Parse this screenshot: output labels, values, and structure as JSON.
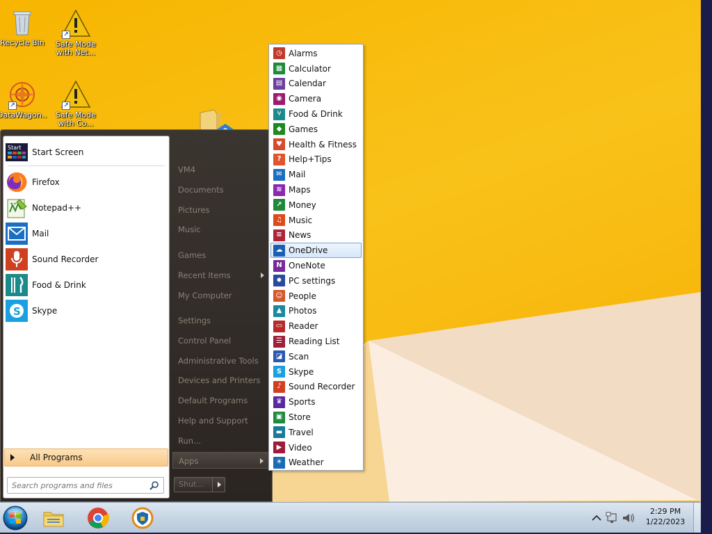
{
  "desktop": {
    "icons": [
      {
        "name": "desktop-icon-recycle-bin",
        "label": "Recycle Bin",
        "icon": "recycle-bin-icon"
      },
      {
        "name": "desktop-icon-safe-mode-net",
        "label": "Safe Mode with Net...",
        "icon": "warning-icon"
      },
      {
        "name": "desktop-icon-datawagon",
        "label": "DataWagon...",
        "icon": "datawagon-icon"
      },
      {
        "name": "desktop-icon-safe-mode",
        "label": "Safe Mode with Co...",
        "icon": "warning-icon"
      }
    ]
  },
  "start_menu": {
    "pinned": [
      {
        "label": "Start Screen",
        "icon": "start-screen-icon"
      },
      {
        "label": "Firefox",
        "icon": "firefox-icon"
      },
      {
        "label": "Notepad++",
        "icon": "notepadpp-icon"
      },
      {
        "label": "Mail",
        "icon": "mail-icon"
      },
      {
        "label": "Sound Recorder",
        "icon": "microphone-icon"
      },
      {
        "label": "Food & Drink",
        "icon": "fork-knife-icon"
      },
      {
        "label": "Skype",
        "icon": "skype-icon"
      }
    ],
    "all_programs_label": "All Programs",
    "search_placeholder": "Search programs and files",
    "right_pane": [
      {
        "label": "VM4"
      },
      {
        "label": "Documents"
      },
      {
        "label": "Pictures"
      },
      {
        "label": "Music"
      },
      {
        "label": "Games"
      },
      {
        "label": "Recent Items"
      },
      {
        "label": "My Computer"
      },
      {
        "label": "Settings"
      },
      {
        "label": "Control Panel"
      },
      {
        "label": "Administrative Tools"
      },
      {
        "label": "Devices and Printers"
      },
      {
        "label": "Default Programs"
      },
      {
        "label": "Help and Support"
      },
      {
        "label": "Run..."
      },
      {
        "label": "Apps"
      }
    ],
    "shutdown_label": "Shut..."
  },
  "apps_menu": {
    "selected": "OneDrive",
    "items": [
      {
        "label": "Alarms",
        "icon": "alarm-icon",
        "color": "#c0392b"
      },
      {
        "label": "Calculator",
        "icon": "calculator-icon",
        "color": "#1e8a3c"
      },
      {
        "label": "Calendar",
        "icon": "calendar-icon",
        "color": "#6b3fa0"
      },
      {
        "label": "Camera",
        "icon": "camera-icon",
        "color": "#9b1b6e"
      },
      {
        "label": "Food & Drink",
        "icon": "fork-knife-icon",
        "color": "#1b8a8a"
      },
      {
        "label": "Games",
        "icon": "gamepad-icon",
        "color": "#1e8a1e"
      },
      {
        "label": "Health & Fitness",
        "icon": "heart-icon",
        "color": "#d84a2b"
      },
      {
        "label": "Help+Tips",
        "icon": "help-icon",
        "color": "#e0562a"
      },
      {
        "label": "Mail",
        "icon": "mail-icon",
        "color": "#1a6fc2"
      },
      {
        "label": "Maps",
        "icon": "map-icon",
        "color": "#8a2ab0"
      },
      {
        "label": "Money",
        "icon": "chart-icon",
        "color": "#1f8a3a"
      },
      {
        "label": "Music",
        "icon": "headphones-icon",
        "color": "#e04a1a"
      },
      {
        "label": "News",
        "icon": "news-icon",
        "color": "#b0243a"
      },
      {
        "label": "OneDrive",
        "icon": "cloud-icon",
        "color": "#1a5fb4"
      },
      {
        "label": "OneNote",
        "icon": "onenote-icon",
        "color": "#7a2a9a"
      },
      {
        "label": "PC settings",
        "icon": "gear-icon",
        "color": "#2a4aa0"
      },
      {
        "label": "People",
        "icon": "people-icon",
        "color": "#d8552a"
      },
      {
        "label": "Photos",
        "icon": "photo-icon",
        "color": "#1a8aa0"
      },
      {
        "label": "Reader",
        "icon": "reader-icon",
        "color": "#b82a2a"
      },
      {
        "label": "Reading List",
        "icon": "list-icon",
        "color": "#a0203a"
      },
      {
        "label": "Scan",
        "icon": "scan-icon",
        "color": "#2a5ab0"
      },
      {
        "label": "Skype",
        "icon": "skype-icon",
        "color": "#1aa0e0"
      },
      {
        "label": "Sound Recorder",
        "icon": "microphone-icon",
        "color": "#d04020"
      },
      {
        "label": "Sports",
        "icon": "trophy-icon",
        "color": "#5a2aa0"
      },
      {
        "label": "Store",
        "icon": "store-icon",
        "color": "#1e8a3c"
      },
      {
        "label": "Travel",
        "icon": "suitcase-icon",
        "color": "#1a7a9a"
      },
      {
        "label": "Video",
        "icon": "video-icon",
        "color": "#a01a3a"
      },
      {
        "label": "Weather",
        "icon": "sun-icon",
        "color": "#1a6ab4"
      }
    ]
  },
  "taskbar": {
    "apps": [
      {
        "name": "taskbar-file-explorer",
        "icon": "folder-icon"
      },
      {
        "name": "taskbar-chrome",
        "icon": "chrome-icon"
      },
      {
        "name": "taskbar-vpn",
        "icon": "shield-icon"
      }
    ],
    "time": "2:29 PM",
    "date": "1/22/2023"
  },
  "colors": {
    "wallpaper": "#f7b500",
    "start_menu_bg": "#2a2521",
    "highlight": "#f9c98a",
    "selection": "#d7e7fa"
  }
}
